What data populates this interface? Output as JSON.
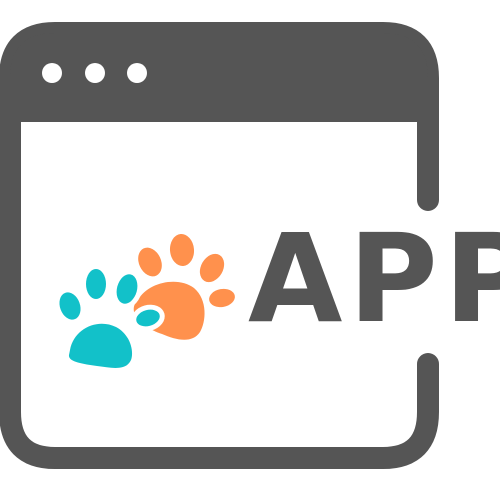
{
  "icon": {
    "name": "app-window-with-paw-prints-icon",
    "window_dots": 3,
    "label": "APP",
    "colors": {
      "frame": "#555555",
      "dots": "#ffffff",
      "background": "#ffffff",
      "paw_front": "#12c1c9",
      "paw_back": "#ff914d",
      "label": "#555555"
    }
  }
}
